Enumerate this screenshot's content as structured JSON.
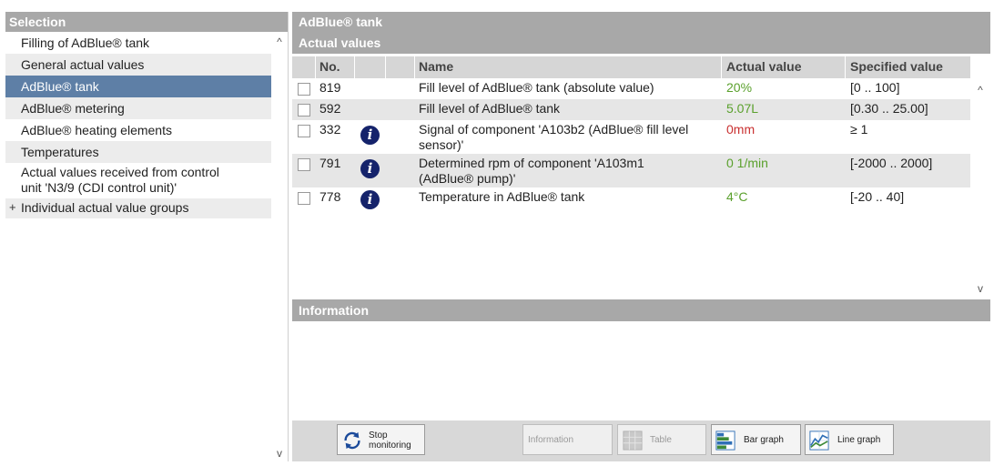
{
  "selection": {
    "header": "Selection",
    "items": [
      {
        "label": "Filling of AdBlue® tank"
      },
      {
        "label": "General actual values"
      },
      {
        "label": "AdBlue® tank"
      },
      {
        "label": "AdBlue® metering"
      },
      {
        "label": "AdBlue® heating elements"
      },
      {
        "label": "Temperatures"
      },
      {
        "label_line1": "Actual values received from control",
        "label_line2": "unit 'N3/9 (CDI control unit)'"
      },
      {
        "label": "Individual actual value groups",
        "expander": "+"
      }
    ],
    "active_index": 2
  },
  "main": {
    "title": "AdBlue® tank",
    "subtitle": "Actual values",
    "columns": {
      "no": "No.",
      "name": "Name",
      "actual": "Actual value",
      "specified": "Specified value"
    },
    "rows": [
      {
        "no": "819",
        "name_line1": "Fill level of AdBlue® tank (absolute value)",
        "name_line2": "",
        "actual": "20%",
        "actual_color": "#5aa02c",
        "specified": "[0 .. 100]",
        "info": false
      },
      {
        "no": "592",
        "name_line1": "Fill level of AdBlue® tank",
        "name_line2": "",
        "actual": "5.07L",
        "actual_color": "#5aa02c",
        "specified": "[0.30 .. 25.00]",
        "info": false
      },
      {
        "no": "332",
        "name_line1": "Signal of component 'A103b2 (AdBlue® fill level",
        "name_line2": "sensor)'",
        "actual": "0mm",
        "actual_color": "#c93030",
        "specified": "≥ 1",
        "info": true
      },
      {
        "no": "791",
        "name_line1": "Determined rpm of component 'A103m1",
        "name_line2": "(AdBlue® pump)'",
        "actual": "0 1/min",
        "actual_color": "#5aa02c",
        "specified": "[-2000 .. 2000]",
        "info": true
      },
      {
        "no": "778",
        "name_line1": "Temperature in AdBlue® tank",
        "name_line2": "",
        "actual": "4°C",
        "actual_color": "#5aa02c",
        "specified": "[-20 .. 40]",
        "info": true
      }
    ],
    "information_header": "Information"
  },
  "toolbar": {
    "stop_line1": "Stop",
    "stop_line2": "monitoring",
    "information": "Information",
    "table": "Table",
    "bar_graph": "Bar graph",
    "line_graph": "Line graph"
  },
  "icons": {
    "info": "i",
    "scroll_up": "^",
    "scroll_down": "v"
  }
}
